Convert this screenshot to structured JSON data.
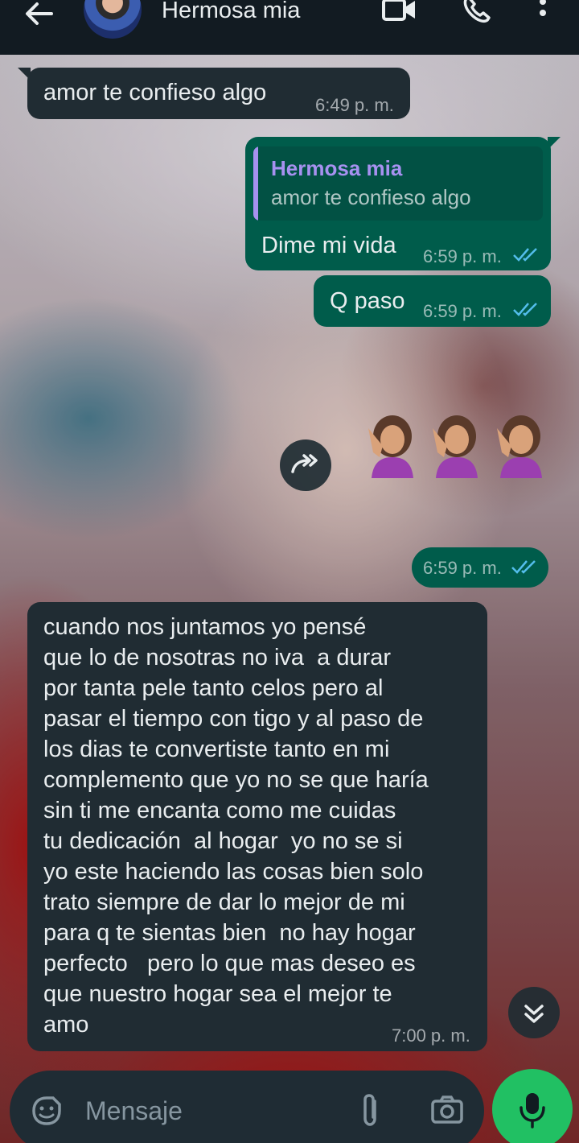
{
  "header": {
    "contact_name": "Hermosa mia"
  },
  "messages": [
    {
      "id": "m1",
      "direction": "in",
      "text": "amor te confieso algo",
      "time": "6:49 p. m."
    },
    {
      "id": "m2",
      "direction": "out",
      "reply_to": {
        "name": "Hermosa mia",
        "text": "amor te confieso algo"
      },
      "text": "Dime mi vida",
      "time": "6:59 p. m.",
      "status": "read"
    },
    {
      "id": "m3",
      "direction": "out",
      "text": "Q paso",
      "time": "6:59 p. m.",
      "status": "read"
    },
    {
      "id": "m4",
      "direction": "out",
      "sticker": "woman-tipping-hand-emoji x3",
      "time": "6:59 p. m.",
      "status": "read"
    },
    {
      "id": "m5",
      "direction": "in",
      "text": "cuando nos juntamos yo pensé\nque lo de nosotras no iva  a durar\npor tanta pele tanto celos pero al\npasar el tiempo con tigo y al paso de\nlos dias te convertiste tanto en mi\ncomplemento que yo no se que haría\nsin ti me encanta como me cuidas\ntu dedicación  al hogar  yo no se si\nyo este haciendo las cosas bien solo\ntrato siempre de dar lo mejor de mi\npara q te sientas bien  no hay hogar\nperfecto   pero lo que mas deseo es\nque nuestro hogar sea el mejor te\namo",
      "time": "7:00 p. m."
    }
  ],
  "composer": {
    "placeholder": "Mensaje"
  },
  "colors": {
    "header_bg": "#121b22",
    "incoming_bubble": "#202c33",
    "outgoing_bubble": "#005c4b",
    "read_ticks": "#53bdeb",
    "mic_button": "#21c063",
    "quote_name": "#a791f0"
  },
  "icons": [
    "back-arrow-icon",
    "video-call-icon",
    "phone-icon",
    "more-options-icon",
    "forward-icon",
    "scroll-down-icon",
    "sticker-icon",
    "attach-icon",
    "camera-icon",
    "mic-icon"
  ]
}
